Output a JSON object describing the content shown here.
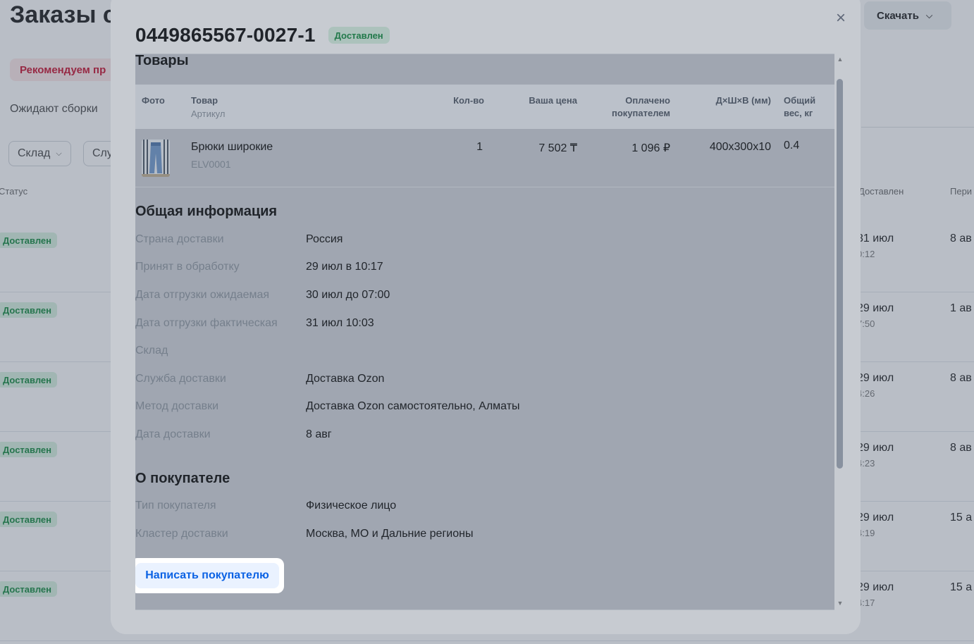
{
  "background": {
    "title": "Заказы с",
    "download_label": "Скачать",
    "recommend_label": "Рекомендуем пр",
    "tab_label": "Ожидают сборки",
    "filters": [
      "Склад",
      "Слу"
    ],
    "columns": {
      "status": "Статус",
      "delivered": "Доставлен",
      "period": "Пери"
    },
    "rows": [
      {
        "status": "Доставлен",
        "date": "31 июл",
        "time": "0:12",
        "period": "8 ав"
      },
      {
        "status": "Доставлен",
        "date": "29 июл",
        "time": "7:50",
        "period": "1 ав"
      },
      {
        "status": "Доставлен",
        "date": "29 июл",
        "time": "4:26",
        "period": "8 ав"
      },
      {
        "status": "Доставлен",
        "date": "29 июл",
        "time": "4:23",
        "period": "8 ав"
      },
      {
        "status": "Доставлен",
        "date": "29 июл",
        "time": "4:19",
        "period": "15 а"
      },
      {
        "status": "Доставлен",
        "date": "29 июл",
        "time": "4:17",
        "period": "15 а"
      }
    ]
  },
  "modal": {
    "order_number": "0449865567-0027-1",
    "status": "Доставлен",
    "close_label": "×",
    "products": {
      "title": "Товары",
      "columns": {
        "photo": "Фото",
        "product": "Товар",
        "product_sub": "Артикул",
        "qty": "Кол-во",
        "price": "Ваша цена",
        "paid_1": "Оплачено",
        "paid_2": "покупателем",
        "dims": "Д×Ш×В (мм)",
        "weight_1": "Общий",
        "weight_2": "вес, кг"
      },
      "items": [
        {
          "name": "Брюки широкие",
          "sku": "ELV0001",
          "qty": "1",
          "price": "7 502 ₸",
          "paid": "1 096 ₽",
          "dims": "400x300x10",
          "weight": "0.4"
        }
      ]
    },
    "general": {
      "title": "Общая информация",
      "rows": [
        {
          "label": "Страна доставки",
          "value": "Россия"
        },
        {
          "label": "Принят в обработку",
          "value": "29 июл в 10:17"
        },
        {
          "label": "Дата отгрузки ожидаемая",
          "value": "30 июл до 07:00"
        },
        {
          "label": "Дата отгрузки фактическая",
          "value": "31 июл 10:03"
        },
        {
          "label": "Склад",
          "value": ""
        },
        {
          "label": "Служба доставки",
          "value": "Доставка Ozon"
        },
        {
          "label": "Метод доставки",
          "value": "Доставка Ozon самостоятельно, Алматы"
        },
        {
          "label": "Дата доставки",
          "value": "8 авг"
        }
      ]
    },
    "buyer": {
      "title": "О покупателе",
      "rows": [
        {
          "label": "Тип покупателя",
          "value": "Физическое лицо"
        },
        {
          "label": "Кластер доставки",
          "value": "Москва, МО и Дальние регионы"
        }
      ],
      "write_button": "Написать покупателю"
    }
  },
  "colors": {
    "accent": "#0b62e4",
    "status_green": "#128a3e",
    "status_green_bg": "#d9f2e1",
    "danger": "#c8102e"
  }
}
